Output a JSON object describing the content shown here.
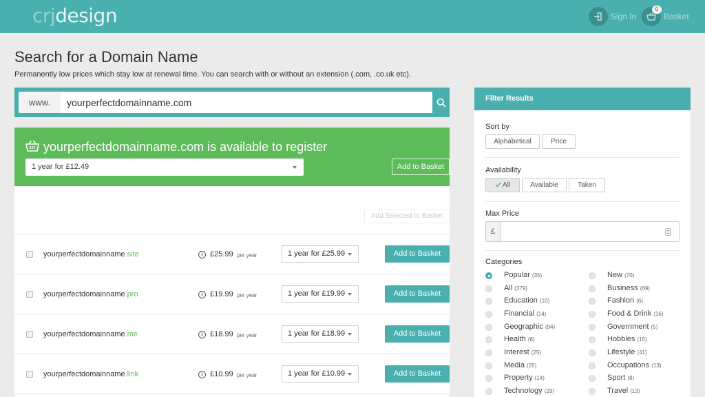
{
  "header": {
    "logo_part1": "crj",
    "logo_part2": "design",
    "sign_in_label": "Sign In",
    "basket_label": "Basket",
    "basket_count": "0"
  },
  "page": {
    "title": "Search for a Domain Name",
    "subtitle": "Permanently low prices which stay low at renewal time. You can search with or without an extension (.com, .co.uk etc)."
  },
  "search": {
    "prefix": "www.",
    "value": "yourperfectdomainname.com"
  },
  "available": {
    "message": "yourperfectdomainname.com is available to register",
    "selected_term": "1 year for £12.49",
    "add_label": "Add to Basket"
  },
  "results": {
    "add_selected_label": "Add Selected to Basket",
    "per_year_label": "per year",
    "add_label": "Add to Basket",
    "rows": [
      {
        "name": "yourperfectdomainname",
        "tld": ".site",
        "price": "£25.99",
        "term": "1 year for £25.99"
      },
      {
        "name": "yourperfectdomainname",
        "tld": ".pro",
        "price": "£19.99",
        "term": "1 year for £19.99"
      },
      {
        "name": "yourperfectdomainname",
        "tld": ".me",
        "price": "£18.99",
        "term": "1 year for £18.99"
      },
      {
        "name": "yourperfectdomainname",
        "tld": ".link",
        "price": "£10.99",
        "term": "1 year for £10.99"
      }
    ]
  },
  "filter": {
    "title": "Filter Results",
    "sort_label": "Sort by",
    "sort_options": [
      "Alphabetical",
      "Price"
    ],
    "availability_label": "Availability",
    "availability_options": [
      "All",
      "Available",
      "Taken"
    ],
    "availability_selected": "All",
    "max_price_label": "Max Price",
    "currency_symbol": "£",
    "max_price_value": "",
    "categories_label": "Categories",
    "selected_category": "Popular",
    "categories_left": [
      {
        "name": "Popular",
        "count": "(35)"
      },
      {
        "name": "All",
        "count": "(379)"
      },
      {
        "name": "Education",
        "count": "(10)"
      },
      {
        "name": "Financial",
        "count": "(14)"
      },
      {
        "name": "Geographic",
        "count": "(94)"
      },
      {
        "name": "Health",
        "count": "(8)"
      },
      {
        "name": "Interest",
        "count": "(25)"
      },
      {
        "name": "Media",
        "count": "(25)"
      },
      {
        "name": "Property",
        "count": "(14)"
      },
      {
        "name": "Technology",
        "count": "(29)"
      }
    ],
    "categories_right": [
      {
        "name": "New",
        "count": "(70)"
      },
      {
        "name": "Business",
        "count": "(69)"
      },
      {
        "name": "Fashion",
        "count": "(6)"
      },
      {
        "name": "Food & Drink",
        "count": "(16)"
      },
      {
        "name": "Government",
        "count": "(5)"
      },
      {
        "name": "Hobbies",
        "count": "(15)"
      },
      {
        "name": "Lifestyle",
        "count": "(41)"
      },
      {
        "name": "Occupations",
        "count": "(13)"
      },
      {
        "name": "Sport",
        "count": "(8)"
      },
      {
        "name": "Travel",
        "count": "(13)"
      }
    ]
  },
  "colors": {
    "brand_teal": "#4aafaf",
    "success_green": "#5dbb5a",
    "page_bg": "#ebebeb"
  },
  "icons": {
    "sign_in": "sign-in-icon",
    "basket": "basket-icon",
    "search": "search-icon",
    "info": "info-icon",
    "check": "check-icon"
  }
}
